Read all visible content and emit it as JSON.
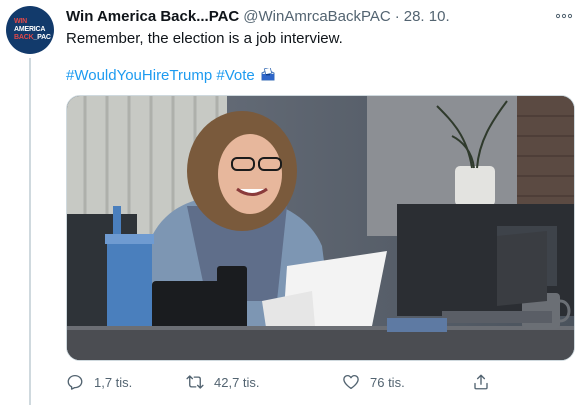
{
  "tweet": {
    "avatar": {
      "line1": "WIN",
      "line2": "AMERICA",
      "line3a": "BACK",
      "line3b": "PAC"
    },
    "name": "Win America Back...PAC",
    "handle": "@WinAmrcaBackPAC",
    "separator": "·",
    "date": "28. 10.",
    "text": "Remember, the election is a job interview.",
    "hashtags": [
      "#WouldYouHireTrump",
      "#Vote"
    ],
    "media_icon": "ballot-box-icon",
    "actions": {
      "replies": "1,7 tis.",
      "retweets": "42,7 tis.",
      "likes": "76 tis."
    }
  },
  "colors": {
    "link": "#1d9bf0",
    "secondary_text": "#536471",
    "avatar_bg": "#123a6b",
    "avatar_accent": "#e34848"
  }
}
